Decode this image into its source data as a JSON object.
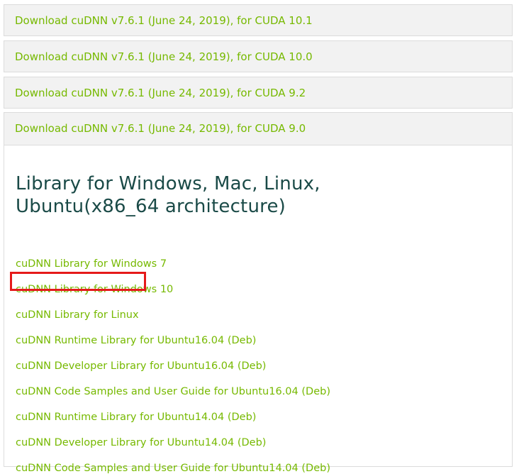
{
  "downloads": [
    {
      "label": "Download cuDNN v7.6.1 (June 24, 2019), for CUDA 10.1"
    },
    {
      "label": "Download cuDNN v7.6.1 (June 24, 2019), for CUDA 10.0"
    },
    {
      "label": "Download cuDNN v7.6.1 (June 24, 2019), for CUDA 9.2"
    },
    {
      "label": "Download cuDNN v7.6.1 (June 24, 2019), for CUDA 9.0"
    }
  ],
  "library_section": {
    "title": "Library for Windows, Mac, Linux, Ubuntu(x86_64 architecture)",
    "links": [
      {
        "label": "cuDNN Library for Windows 7"
      },
      {
        "label": "cuDNN Library for Windows 10"
      },
      {
        "label": "cuDNN Library for Linux"
      },
      {
        "label": "cuDNN Runtime Library for Ubuntu16.04 (Deb)"
      },
      {
        "label": "cuDNN Developer Library for Ubuntu16.04 (Deb)"
      },
      {
        "label": "cuDNN Code Samples and User Guide for Ubuntu16.04 (Deb)"
      },
      {
        "label": "cuDNN Runtime Library for Ubuntu14.04 (Deb)"
      },
      {
        "label": "cuDNN Developer Library for Ubuntu14.04 (Deb)"
      },
      {
        "label": "cuDNN Code Samples and User Guide for Ubuntu14.04 (Deb)"
      }
    ]
  },
  "colors": {
    "link": "#76b900",
    "heading": "#1a4a47",
    "panel_bg": "#f2f2f2",
    "highlight": "#e51a1a"
  }
}
